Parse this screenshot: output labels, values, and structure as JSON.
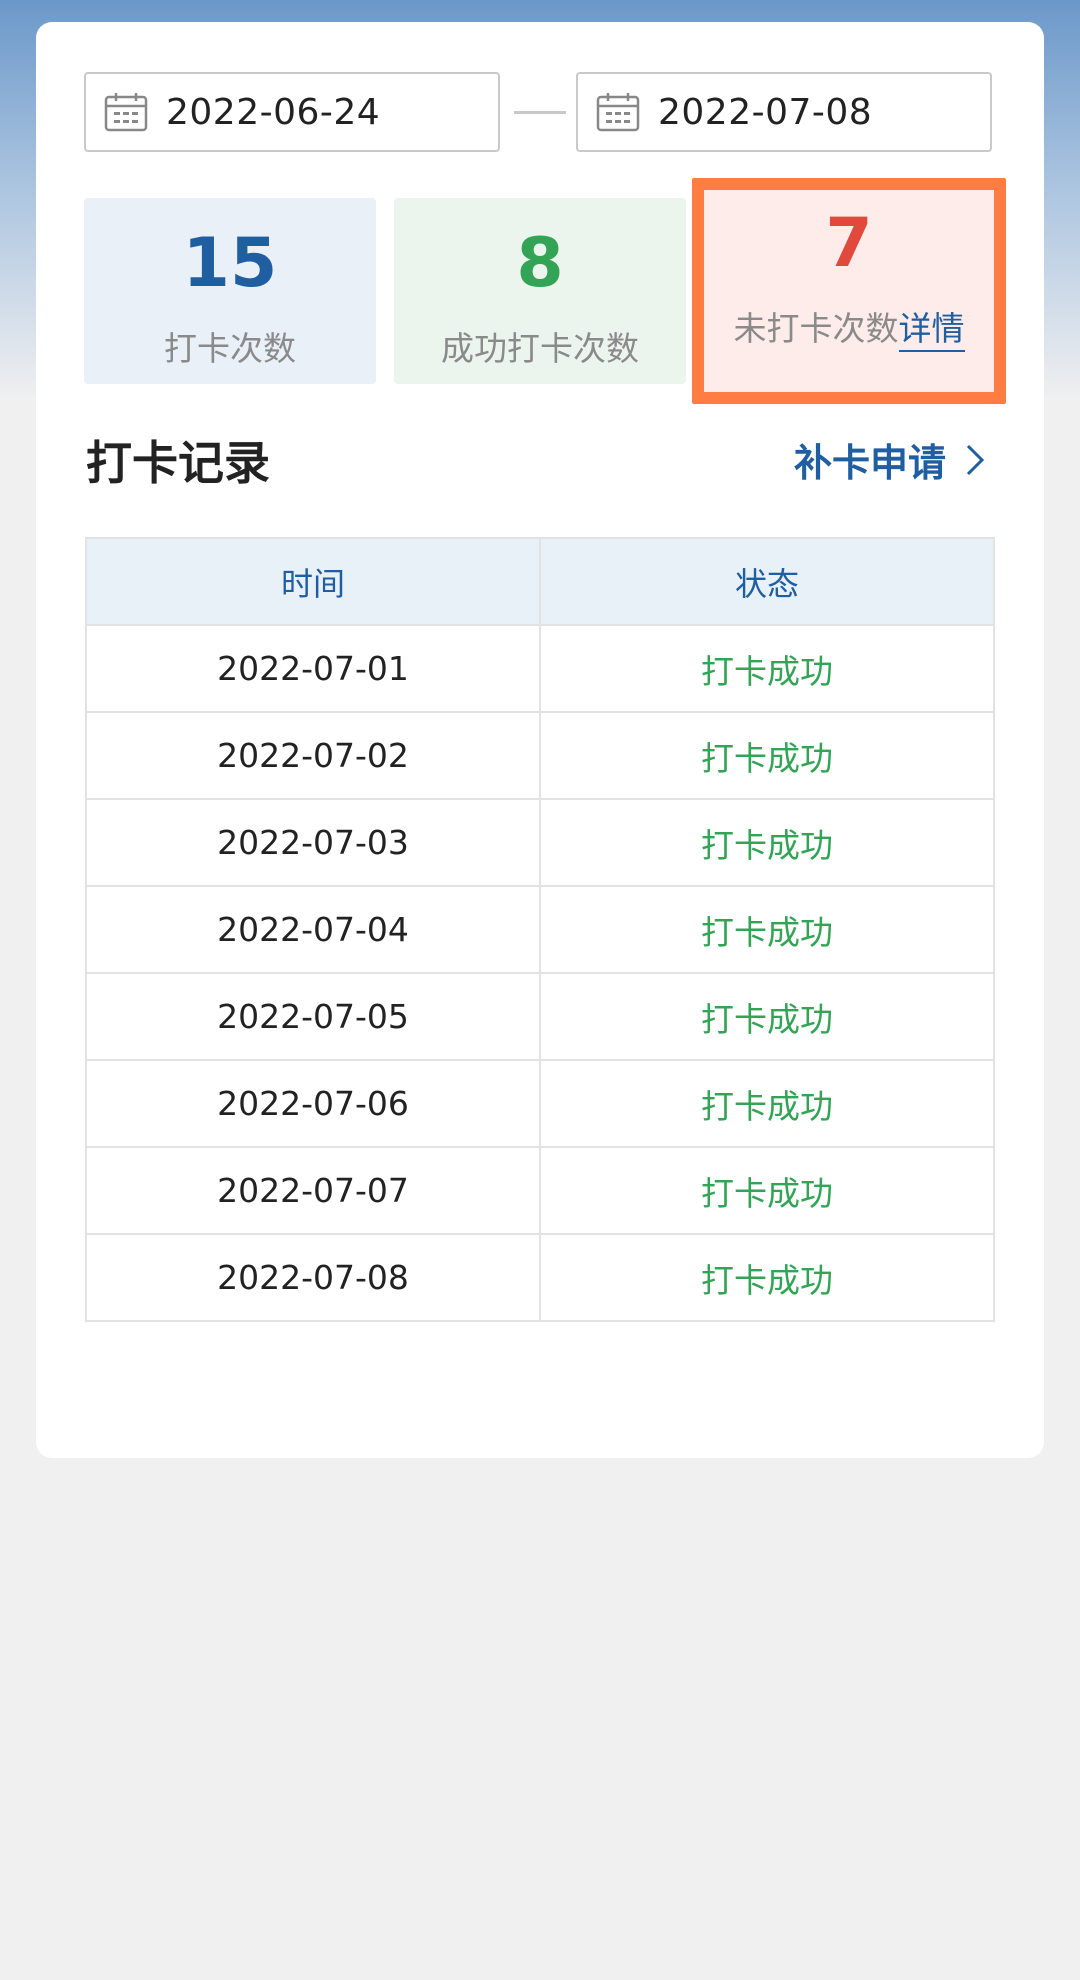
{
  "date_range": {
    "start": "2022-06-24",
    "end": "2022-07-08",
    "icon": "calendar-icon"
  },
  "stats": {
    "total": {
      "value": "15",
      "label": "打卡次数",
      "color": "#1f5ea0"
    },
    "success": {
      "value": "8",
      "label": "成功打卡次数",
      "color": "#33a456"
    },
    "missed": {
      "value": "7",
      "label": "未打卡次数",
      "link": "详情",
      "color": "#e0493c",
      "highlight": "#ff7c42"
    }
  },
  "records": {
    "title": "打卡记录",
    "reissue_label": "补卡申请",
    "columns": [
      "时间",
      "状态"
    ],
    "rows": [
      {
        "time": "2022-07-01",
        "status": "打卡成功"
      },
      {
        "time": "2022-07-02",
        "status": "打卡成功"
      },
      {
        "time": "2022-07-03",
        "status": "打卡成功"
      },
      {
        "time": "2022-07-04",
        "status": "打卡成功"
      },
      {
        "time": "2022-07-05",
        "status": "打卡成功"
      },
      {
        "time": "2022-07-06",
        "status": "打卡成功"
      },
      {
        "time": "2022-07-07",
        "status": "打卡成功"
      },
      {
        "time": "2022-07-08",
        "status": "打卡成功"
      }
    ]
  }
}
